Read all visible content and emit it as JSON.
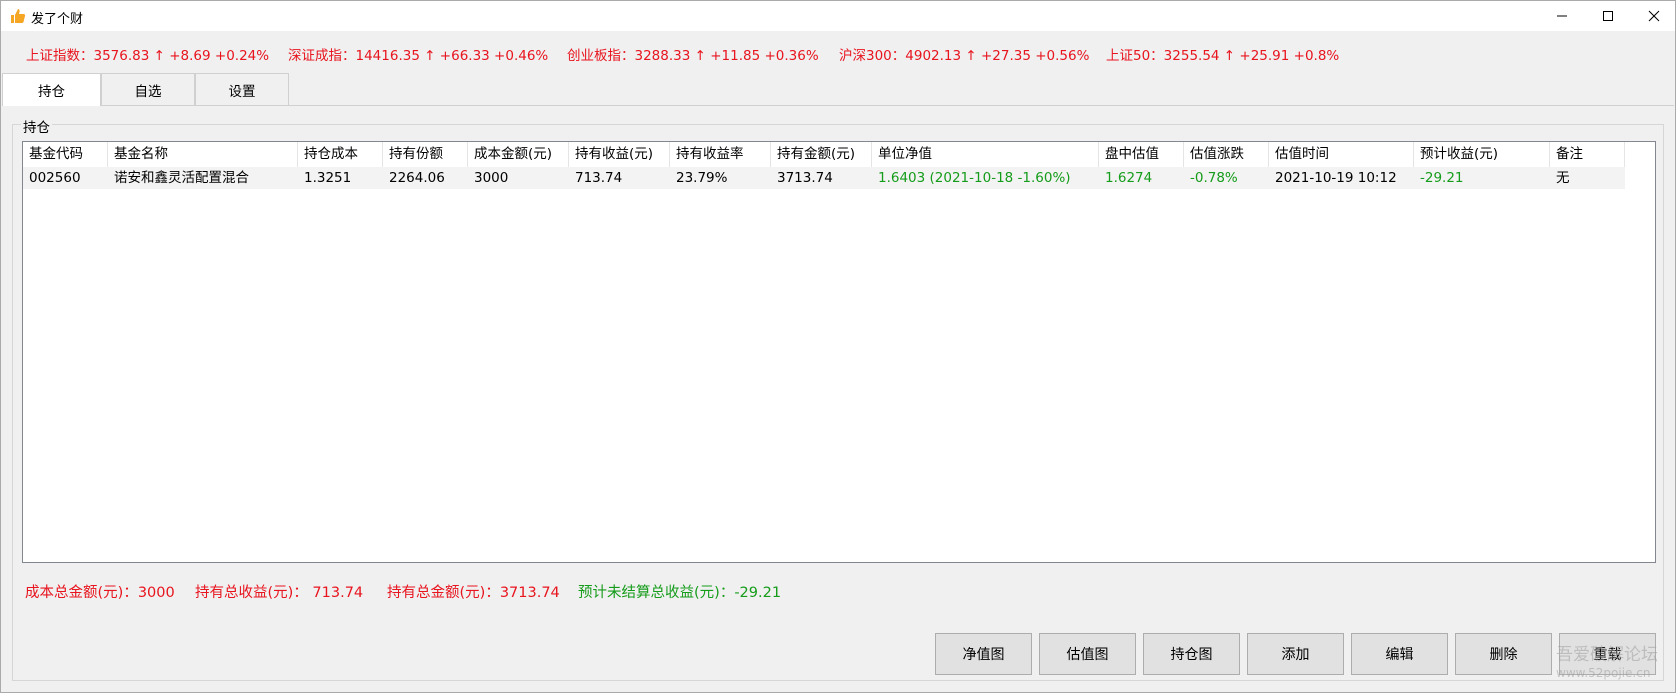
{
  "window": {
    "title": "发了个财"
  },
  "ticker": [
    {
      "text": "上证指数：3576.83 ↑  +8.69  +0.24%"
    },
    {
      "text": "深证成指：14416.35 ↑  +66.33  +0.46%"
    },
    {
      "text": "创业板指：3288.33 ↑  +11.85  +0.36%"
    },
    {
      "text": "沪深300：4902.13 ↑  +27.35  +0.56%"
    },
    {
      "text": "上证50：3255.54 ↑  +25.91  +0.8%"
    }
  ],
  "tabs": [
    {
      "label": "持仓",
      "active": true
    },
    {
      "label": "自选",
      "active": false
    },
    {
      "label": "设置",
      "active": false
    }
  ],
  "holdings": {
    "group_label": "持仓",
    "columns": [
      "基金代码",
      "基金名称",
      "持仓成本",
      "持有份额",
      "成本金额(元)",
      "持有收益(元)",
      "持有收益率",
      "持有金额(元)",
      "单位净值",
      "盘中估值",
      "估值涨跌",
      "估值时间",
      "预计收益(元)",
      "备注"
    ],
    "rows": [
      [
        "002560",
        "诺安和鑫灵活配置混合",
        "1.3251",
        "2264.06",
        "3000",
        "713.74",
        "23.79%",
        "3713.74",
        "1.6403 (2021-10-18  -1.60%)",
        "1.6274",
        "-0.78%",
        "2021-10-19 10:12",
        "-29.21",
        "无"
      ]
    ]
  },
  "summary": {
    "cost_total": "成本总金额(元)：3000",
    "hold_profit": "持有总收益(元)： 713.74",
    "hold_amount": "持有总金额(元)：3713.74",
    "expected_profit": "预计未结算总收益(元)：-29.21"
  },
  "buttons": {
    "nav_chart": "净值图",
    "estimate_chart": "估值图",
    "holding_chart": "持仓图",
    "add": "添加",
    "edit": "编辑",
    "delete": "删除",
    "reload": "重载"
  },
  "watermark": {
    "line1": "吾爱破解论坛",
    "line2": "www.52pojie.cn"
  },
  "colors": {
    "up": "#e8141e",
    "down": "#159c1a",
    "row_bg": "#f3f3f3"
  }
}
